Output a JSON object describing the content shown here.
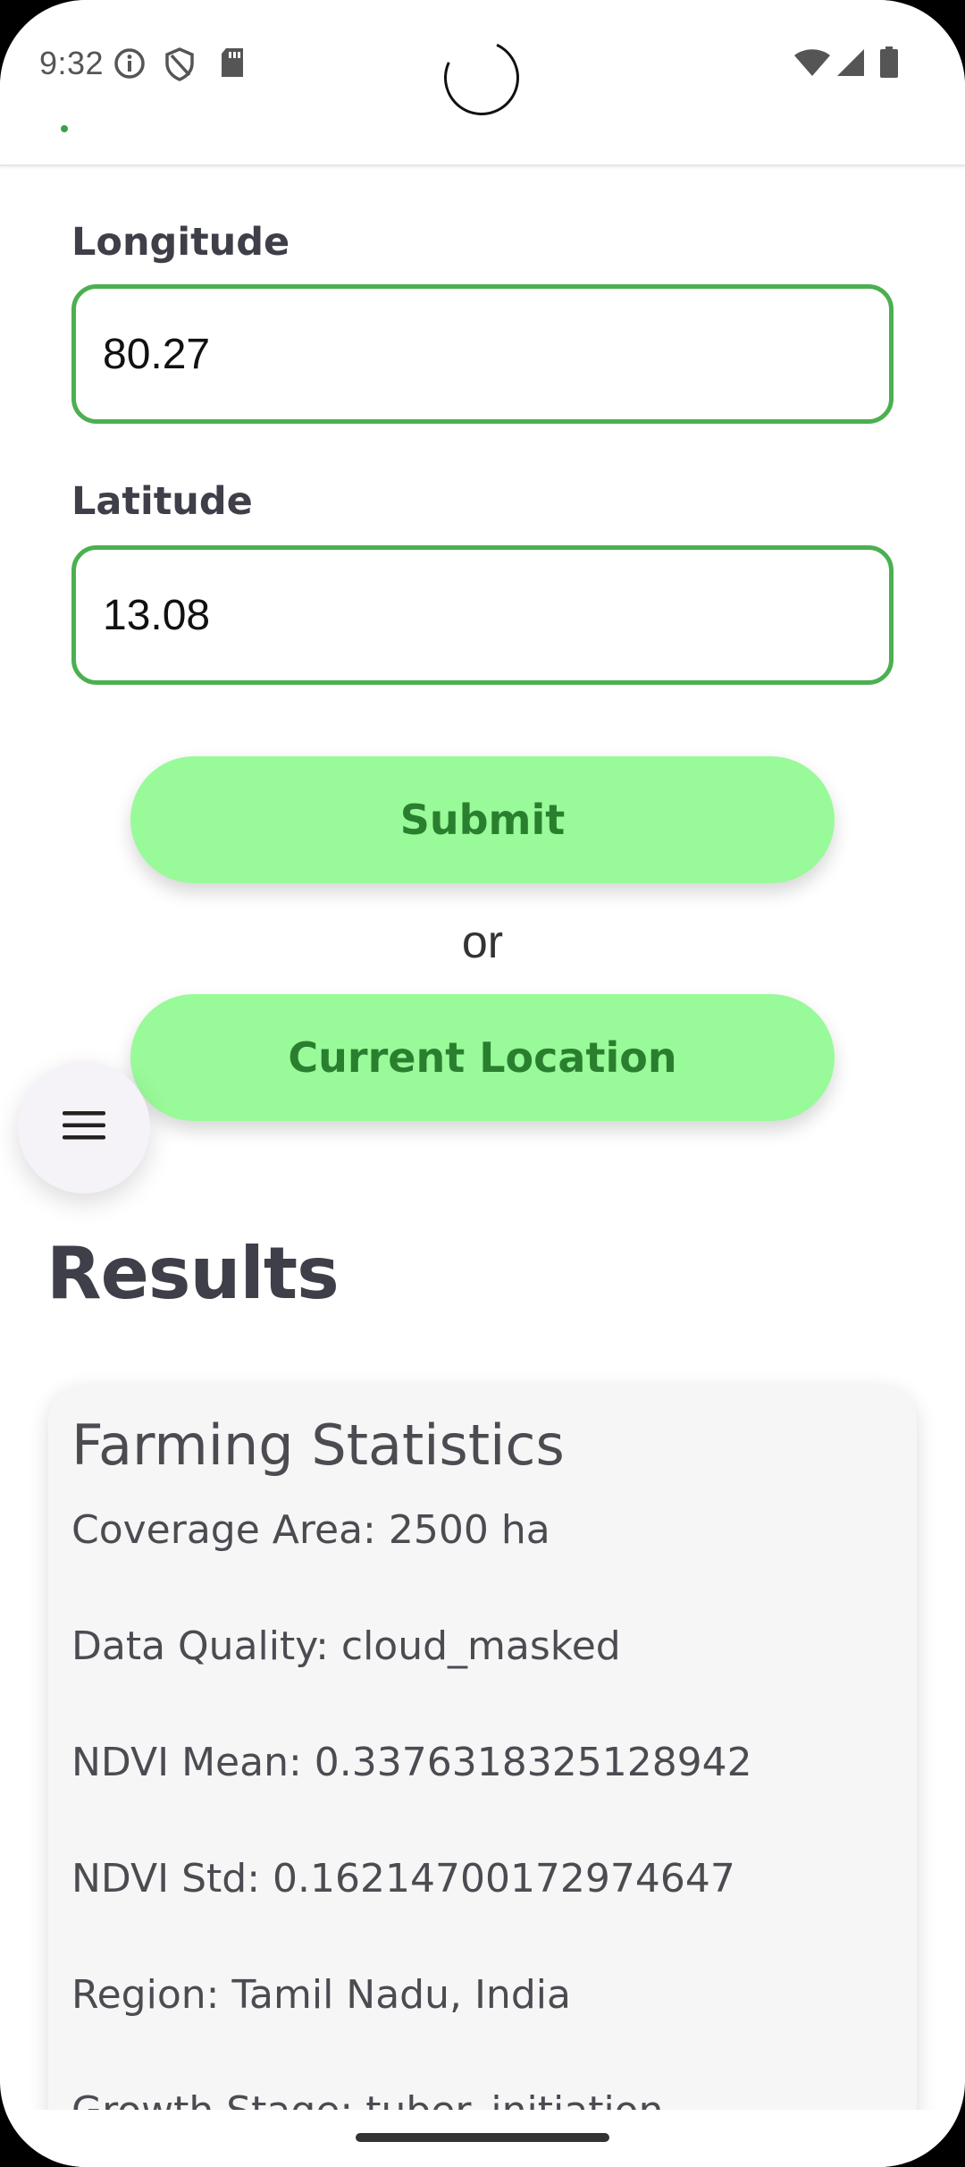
{
  "status_bar": {
    "time": "9:32",
    "left_icons": [
      "info-icon",
      "shield-icon",
      "sd-card-icon"
    ],
    "right_icons": [
      "wifi-icon",
      "signal-icon",
      "battery-icon"
    ]
  },
  "form": {
    "longitude_label": "Longitude",
    "longitude_value": "80.27",
    "latitude_label": "Latitude",
    "latitude_value": "13.08",
    "submit_label": "Submit",
    "or_text": "or",
    "current_location_label": "Current Location"
  },
  "fab": {
    "icon": "menu-icon"
  },
  "results": {
    "title": "Results",
    "card_title": "Farming Statistics",
    "stats": [
      "Coverage Area: 2500 ha",
      "Data Quality: cloud_masked",
      "NDVI Mean: 0.3376318325128942",
      "NDVI Std: 0.16214700172974647",
      "Region: Tamil Nadu, India",
      "Growth Stage: tuber_initiation"
    ]
  },
  "colors": {
    "accent_green": "#4caf50",
    "button_bg": "#99fa99",
    "button_text": "#2a7f2f",
    "heading_text": "#3f3f4a"
  }
}
